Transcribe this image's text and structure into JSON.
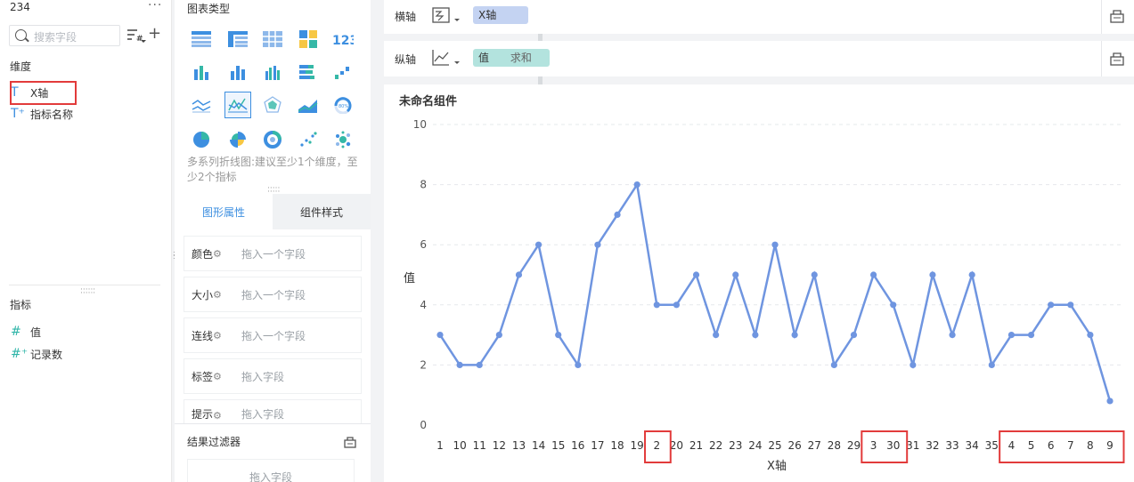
{
  "fields_panel": {
    "dataset_name": "234",
    "more": "···",
    "search_placeholder": "搜索字段",
    "dimensions_title": "维度",
    "dimensions": [
      {
        "type_icon": "T",
        "label": "X轴"
      },
      {
        "type_icon": "T⁺",
        "label": "指标名称"
      }
    ],
    "metrics_title": "指标",
    "metrics": [
      {
        "type_icon": "#",
        "label": "值"
      },
      {
        "type_icon": "#⁺",
        "label": "记录数"
      }
    ]
  },
  "chart_types": {
    "title": "图表类型",
    "hint": "多系列折线图:建议至少1个维度，至少2个指标",
    "tabs": [
      "图形属性",
      "组件样式"
    ],
    "attributes": [
      {
        "name": "颜色",
        "placeholder": "拖入一个字段"
      },
      {
        "name": "大小",
        "placeholder": "拖入一个字段"
      },
      {
        "name": "连线",
        "placeholder": "拖入一个字段"
      },
      {
        "name": "标签",
        "placeholder": "拖入字段"
      },
      {
        "name": "提示",
        "placeholder": "拖入字段"
      }
    ],
    "filter_title": "结果过滤器",
    "filter_placeholder": "拖入字段"
  },
  "x_axis_bar": {
    "label": "横轴",
    "field": "X轴",
    "pill_color": "#c4d3f2"
  },
  "y_axis_bar": {
    "label": "纵轴",
    "field": "值",
    "agg": "求和",
    "pill_color": "#b3e3de"
  },
  "component": {
    "title": "未命名组件"
  },
  "colors": {
    "accent": "#3d8fe0",
    "line": "#6f95e0",
    "highlight": "#e23b3b"
  },
  "chart_data": {
    "type": "line",
    "title": "",
    "xlabel": "X轴",
    "ylabel": "值",
    "ylim": [
      0,
      10
    ],
    "yticks": [
      0,
      2,
      4,
      6,
      8,
      10
    ],
    "categories": [
      "1",
      "10",
      "11",
      "12",
      "13",
      "14",
      "15",
      "16",
      "17",
      "18",
      "19",
      "2",
      "20",
      "21",
      "22",
      "23",
      "24",
      "25",
      "26",
      "27",
      "28",
      "29",
      "3",
      "30",
      "31",
      "32",
      "33",
      "34",
      "35",
      "4",
      "5",
      "6",
      "7",
      "8",
      "9"
    ],
    "values": [
      3,
      2,
      2,
      3,
      5,
      6,
      3,
      2,
      6,
      7,
      8,
      4,
      4,
      5,
      3,
      5,
      3,
      6,
      3,
      5,
      2,
      3,
      5,
      4,
      2,
      5,
      3,
      5,
      2,
      3,
      3,
      4,
      4,
      3,
      0.8
    ],
    "grid": true,
    "highlighted_categories": [
      "2",
      "3",
      "30",
      "4",
      "5",
      "6",
      "7",
      "8",
      "9"
    ]
  }
}
